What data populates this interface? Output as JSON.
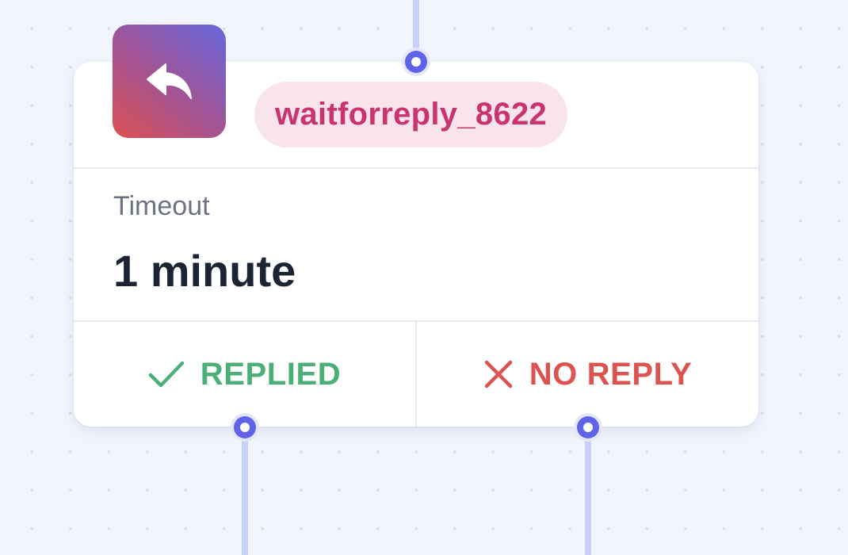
{
  "node": {
    "type_icon": "reply-arrow-icon",
    "name": "waitforreply_8622",
    "field": {
      "label": "Timeout",
      "value": "1 minute"
    },
    "branches": [
      {
        "label": "REPLIED",
        "icon": "check-icon",
        "color": "#4caf78"
      },
      {
        "label": "NO REPLY",
        "icon": "x-icon",
        "color": "#dd5350"
      }
    ]
  },
  "colors": {
    "port": "#5f63e8",
    "connector": "#c8d0fb",
    "chip_background": "#f9e4ee",
    "chip_text": "#c9346a"
  }
}
